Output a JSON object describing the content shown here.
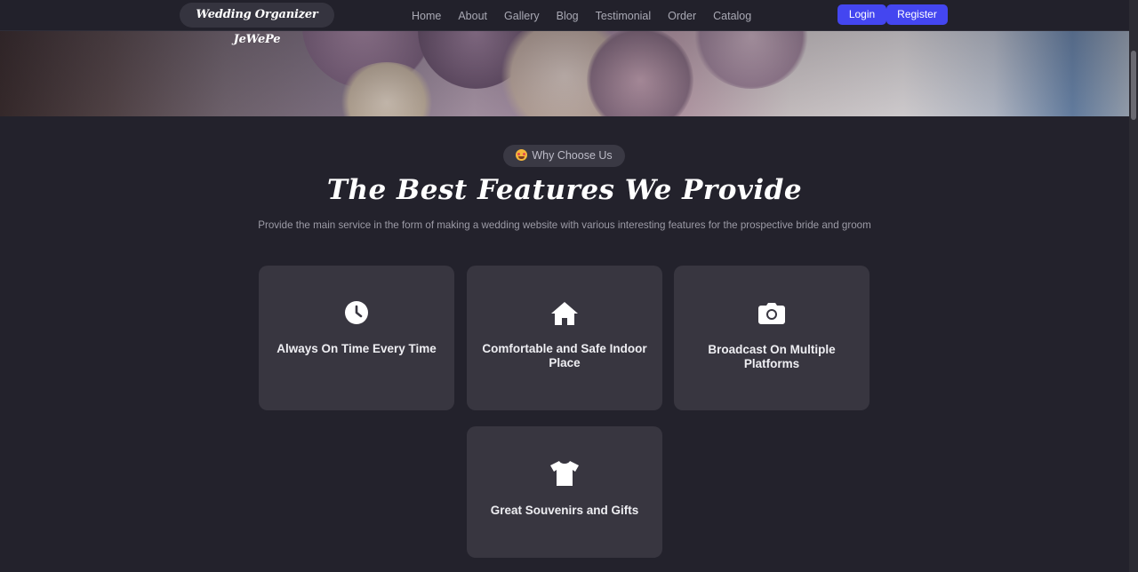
{
  "navbar": {
    "brand": "Wedding Organizer JeWePe",
    "links": [
      "Home",
      "About",
      "Gallery",
      "Blog",
      "Testimonial",
      "Order",
      "Catalog"
    ],
    "login_label": "Login",
    "register_label": "Register",
    "accent_color": "#4446f0"
  },
  "section": {
    "badge": "Why Choose Us",
    "badge_icon": "star-struck-emoji-icon",
    "title": "The Best Features We Provide",
    "subtitle": "Provide the main service in the form of making a wedding website with various interesting features for the prospective bride and groom"
  },
  "features": [
    {
      "icon": "clock-icon",
      "label": "Always On Time Every Time"
    },
    {
      "icon": "home-icon",
      "label": "Comfortable and Safe Indoor Place"
    },
    {
      "icon": "camera-icon",
      "label": "Broadcast On Multiple Platforms"
    },
    {
      "icon": "shirt-icon",
      "label": "Great Souvenirs and Gifts"
    }
  ],
  "colors": {
    "background": "#23222c",
    "card": "#383640",
    "text_muted": "#9c9ba6"
  }
}
